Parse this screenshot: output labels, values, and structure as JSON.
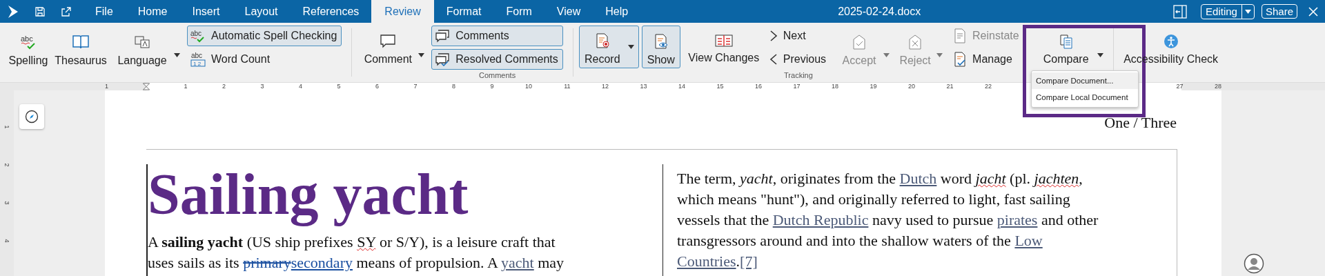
{
  "app_bar": {
    "tabs": [
      {
        "label": "File",
        "selected": false
      },
      {
        "label": "Home",
        "selected": false
      },
      {
        "label": "Insert",
        "selected": false
      },
      {
        "label": "Layout",
        "selected": false
      },
      {
        "label": "References",
        "selected": false
      },
      {
        "label": "Review",
        "selected": true
      },
      {
        "label": "Format",
        "selected": false
      },
      {
        "label": "Form",
        "selected": false
      },
      {
        "label": "View",
        "selected": false
      },
      {
        "label": "Help",
        "selected": false
      }
    ],
    "document_title": "2025-02-24.docx",
    "mode": "Editing",
    "share": "Share"
  },
  "ribbon": {
    "spelling_icon_text": "abc",
    "auto_spell_icon_text": "abc",
    "word_count_icon_text": "abc",
    "word_count_icon_digits": "1 2",
    "spelling": "Spelling",
    "thesaurus": "Thesaurus",
    "language": "Language",
    "auto_spell": {
      "label": "Automatic Spell Checking",
      "on": true
    },
    "word_count": "Word Count",
    "comment": "Comment",
    "comments": {
      "label": "Comments",
      "on": true
    },
    "resolved_comments": {
      "label": "Resolved Comments",
      "on": true
    },
    "comments_group": "Comments",
    "record": {
      "label": "Record",
      "on": true
    },
    "show": {
      "label": "Show",
      "on": true
    },
    "view_changes": "View Changes",
    "next": "Next",
    "previous": "Previous",
    "tracking_group": "Tracking",
    "accept": {
      "label": "Accept",
      "disabled": true
    },
    "reject": {
      "label": "Reject",
      "disabled": true
    },
    "reinstate": {
      "label": "Reinstate",
      "disabled": true
    },
    "manage": {
      "label": "Manage",
      "disabled": false
    },
    "compare": "Compare",
    "accessibility_check": "Accessibility Check",
    "compare_menu": [
      {
        "label": "Compare Document...",
        "selected": true
      },
      {
        "label": "Compare Local Document",
        "selected": false
      }
    ]
  },
  "ruler": {
    "before": [
      "1"
    ],
    "marks": [
      "1",
      "2",
      "3",
      "4",
      "5",
      "6",
      "7",
      "8",
      "9",
      "10",
      "11",
      "12",
      "13",
      "14",
      "15",
      "16",
      "17",
      "18",
      "19",
      "20",
      "21",
      "22"
    ],
    "after": [
      "27",
      "28"
    ]
  },
  "vertical_ruler": [
    "1",
    "2",
    "3",
    "4"
  ],
  "page": {
    "header": "One / Three",
    "title": "Sailing yacht",
    "left_paragraph": [
      [
        {
          "kind": "text",
          "text": "A "
        },
        {
          "kind": "bold",
          "text": "sailing yacht"
        },
        {
          "kind": "text",
          "text": " (US ship prefixes "
        },
        {
          "kind": "misspelled",
          "text": "SY"
        },
        {
          "kind": "text",
          "text": " or S/Y), is a leisure craft that"
        }
      ],
      [
        {
          "kind": "text",
          "text": "uses sails as its "
        },
        {
          "kind": "deleted",
          "text": "primary"
        },
        {
          "kind": "inserted",
          "text": "secondary"
        },
        {
          "kind": "text",
          "text": " means of propulsion. A "
        },
        {
          "kind": "link",
          "text": "yacht"
        },
        {
          "kind": "text",
          "text": " may"
        }
      ]
    ],
    "right_paragraph": [
      [
        {
          "kind": "text",
          "text": "The term, "
        },
        {
          "kind": "italic",
          "text": "yacht"
        },
        {
          "kind": "text",
          "text": ", originates from the "
        },
        {
          "kind": "link",
          "text": "Dutch"
        },
        {
          "kind": "text",
          "text": " word "
        },
        {
          "kind": "italic_misspelled",
          "text": "jacht"
        },
        {
          "kind": "text",
          "text": " (pl. "
        },
        {
          "kind": "italic_misspelled",
          "text": "jachten"
        },
        {
          "kind": "text",
          "text": ","
        }
      ],
      [
        {
          "kind": "text",
          "text": "which means \"hunt\"), and originally referred to light, fast sailing"
        }
      ],
      [
        {
          "kind": "text",
          "text": "vessels that the "
        },
        {
          "kind": "link",
          "text": "Dutch Republic"
        },
        {
          "kind": "text",
          "text": " navy used to pursue "
        },
        {
          "kind": "link",
          "text": "pirates"
        },
        {
          "kind": "text",
          "text": " and other"
        }
      ],
      [
        {
          "kind": "text",
          "text": "transgressors around and into the shallow waters of the "
        },
        {
          "kind": "link",
          "text": "Low"
        }
      ],
      [
        {
          "kind": "link",
          "text": "Countries"
        },
        {
          "kind": "text",
          "text": "."
        },
        {
          "kind": "link",
          "text": "[7]"
        }
      ]
    ]
  }
}
